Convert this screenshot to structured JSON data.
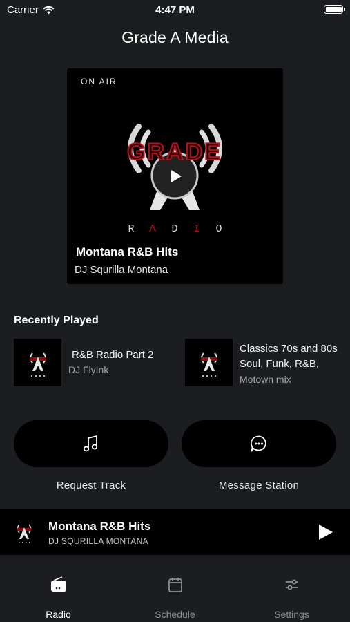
{
  "status_bar": {
    "carrier": "Carrier",
    "time": "4:47 PM"
  },
  "header": {
    "title": "Grade A Media"
  },
  "now_playing_card": {
    "badge": "ON AIR",
    "title": "Montana R&B Hits",
    "host": "DJ Squrilla Montana",
    "logo_text": "GRADE",
    "logo_subtext": [
      "R",
      "A",
      "D",
      "I",
      "O"
    ]
  },
  "recently_played": {
    "heading": "Recently Played",
    "items": [
      {
        "title": "R&B Radio Part 2",
        "host": "DJ FlyInk"
      },
      {
        "title_line1": "Classics 70s and 80s",
        "title_line2": "Soul, Funk, R&B,",
        "host": "Motown mix"
      }
    ]
  },
  "actions": {
    "request_label": "Request Track",
    "message_label": "Message Station"
  },
  "mini_player": {
    "title": "Montana R&B Hits",
    "host": "DJ SQURILLA MONTANA"
  },
  "tabs": [
    {
      "label": "Radio",
      "icon": "radio-icon",
      "active": true
    },
    {
      "label": "Schedule",
      "icon": "calendar-icon",
      "active": false
    },
    {
      "label": "Settings",
      "icon": "sliders-icon",
      "active": false
    }
  ],
  "colors": {
    "background": "#1c1d20",
    "card": "#000000",
    "logo_red": "#b0121b",
    "muted_text": "#8e8e92"
  }
}
